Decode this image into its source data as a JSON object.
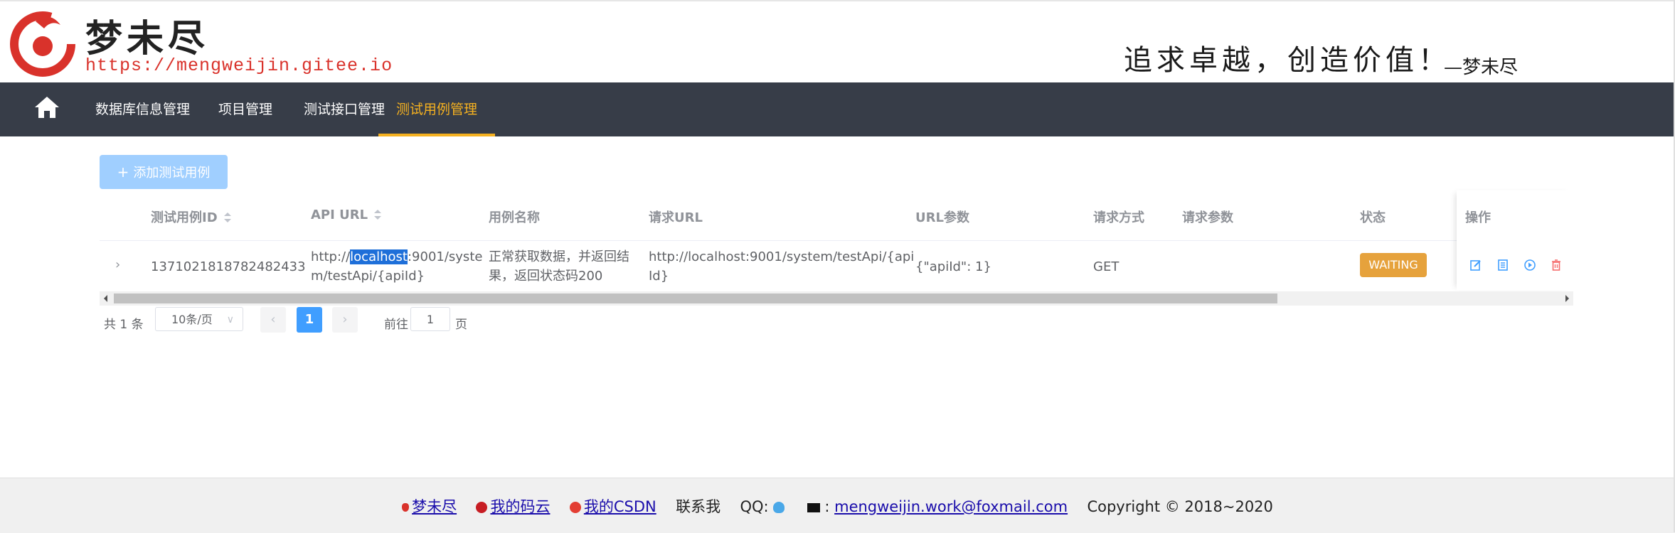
{
  "brand": {
    "name": "梦未尽",
    "url": "https://mengweijin.gitee.io",
    "slogan": "追求卓越，创造价值！",
    "slogan_sign": "—梦未尽"
  },
  "nav": {
    "items": [
      "数据库信息管理",
      "项目管理",
      "测试接口管理",
      "测试用例管理"
    ],
    "active_index": 3
  },
  "toolbar": {
    "add_label": "添加测试用例"
  },
  "table": {
    "columns": [
      "测试用例ID",
      "API URL",
      "用例名称",
      "请求URL",
      "URL参数",
      "请求方式",
      "请求参数",
      "状态",
      "操作"
    ],
    "rows": [
      {
        "id": "1371021818782482433",
        "api_url_prefix": "http://",
        "api_url_highlight": "localhost",
        "api_url_line1_rest": ":9001/syste",
        "api_url_line2": "m/testApi/{apiId}",
        "name_line1": "正常获取数据，并返回结",
        "name_line2": "果，返回状态码200",
        "request_url_line1": "http://localhost:9001/system/testApi/{api",
        "request_url_line2": "Id}",
        "url_params": "{\"apiId\": 1}",
        "method": "GET",
        "request_params": "",
        "status": "WAITING"
      }
    ]
  },
  "pagination": {
    "total_text": "共 1 条",
    "page_size": "10条/页",
    "prev": "‹",
    "next": "›",
    "current": "1",
    "goto_label": "前往",
    "goto_value": "1",
    "goto_unit": "页"
  },
  "footer": {
    "link1": "梦未尽",
    "link2": "我的码云",
    "link3": "我的CSDN",
    "contact": "联系我",
    "qq_label": "QQ:",
    "mail_sep": ":",
    "email": "mengweijin.work@foxmail.com",
    "copyright": "Copyright © 2018~2020"
  },
  "colors": {
    "nav_bg": "#373d48",
    "nav_active": "#f5b120",
    "primary": "#409eff",
    "warning": "#e6a23c",
    "danger": "#f56c6c"
  }
}
